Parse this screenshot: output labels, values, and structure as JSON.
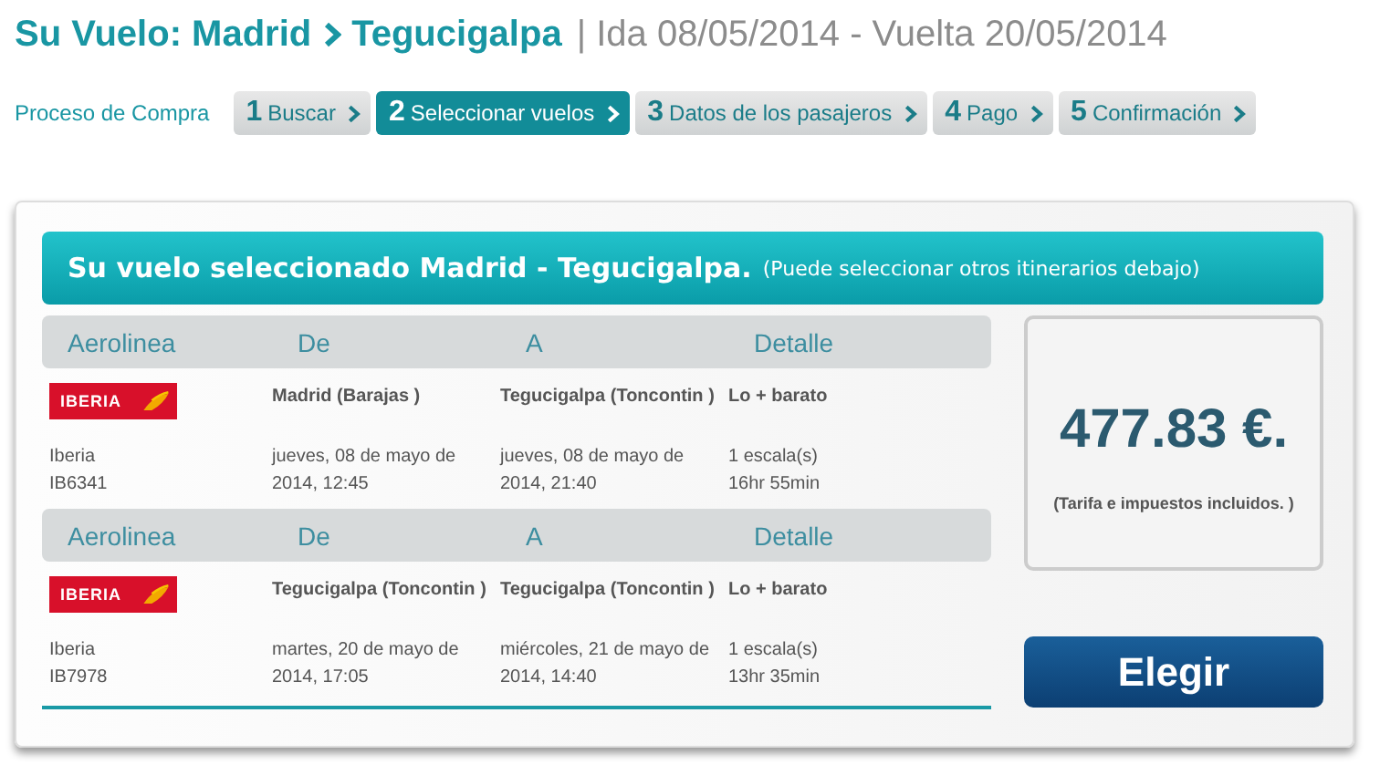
{
  "header": {
    "prefix": "Su Vuelo:",
    "origin": "Madrid",
    "destination": "Tegucigalpa",
    "dates": "| Ida 08/05/2014 - Vuelta 20/05/2014"
  },
  "steps_label": "Proceso de Compra",
  "steps": [
    {
      "number": "1",
      "label": "Buscar",
      "selected": false
    },
    {
      "number": "2",
      "label": "Seleccionar vuelos",
      "selected": true
    },
    {
      "number": "3",
      "label": "Datos de los pasajeros",
      "selected": false
    },
    {
      "number": "4",
      "label": "Pago",
      "selected": false
    },
    {
      "number": "5",
      "label": "Confirmación",
      "selected": false
    }
  ],
  "selection": {
    "title": "Su vuelo seleccionado Madrid - Tegucigalpa.",
    "note": "(Puede seleccionar otros itinerarios debajo)"
  },
  "flights": [
    {
      "columns": [
        "Aerolinea",
        "De",
        "A",
        "Detalle"
      ],
      "logo": "IBERIA",
      "airline": "Iberia",
      "flight": "IB6341",
      "from": "Madrid (Barajas )",
      "from_time": "jueves, 08 de mayo de 2014, 12:45",
      "to": "Tegucigalpa (Toncontin )",
      "to_time": "jueves, 08 de mayo de 2014, 21:40",
      "fare": "Lo + barato",
      "stops": "1 escala(s)",
      "duration": "16hr 55min"
    },
    {
      "columns": [
        "Aerolinea",
        "De",
        "A",
        "Detalle"
      ],
      "logo": "IBERIA",
      "airline": "Iberia",
      "flight": "IB7978",
      "from": "Tegucigalpa (Toncontin )",
      "from_time": "martes, 20 de mayo de 2014, 17:05",
      "to": "Tegucigalpa (Toncontin )",
      "to_time": "miércoles, 21 de mayo de 2014, 14:40",
      "fare": "Lo + barato",
      "stops": "1 escala(s)",
      "duration": "13hr 35min"
    }
  ],
  "price": {
    "amount": "477.83 €.",
    "note": "(Tarifa e impuestos incluidos. )"
  },
  "button": "Elegir"
}
